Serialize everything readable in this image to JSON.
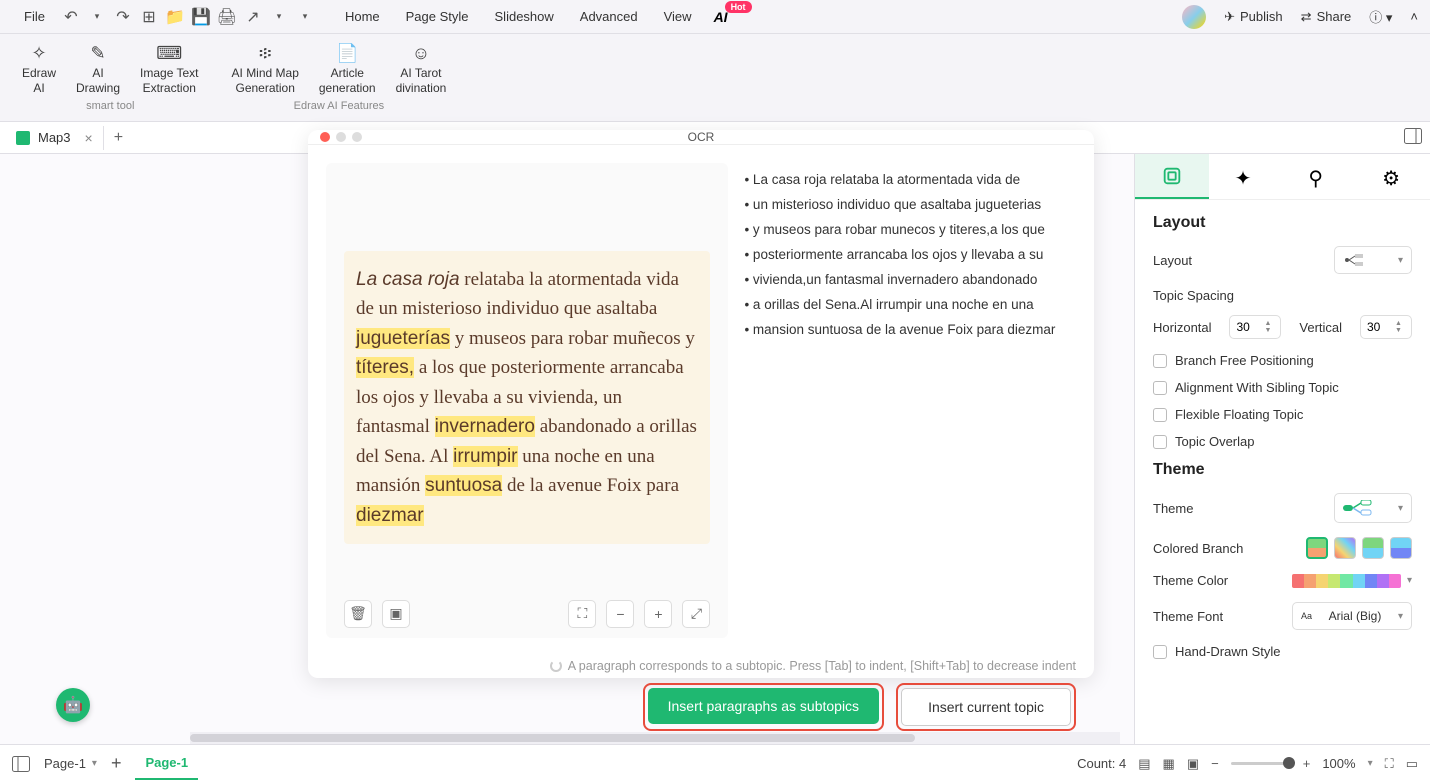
{
  "top_menu": {
    "file": "File",
    "items": [
      "Home",
      "Page Style",
      "Slideshow",
      "Advanced",
      "View"
    ],
    "ai_label": "AI",
    "hot_badge": "Hot",
    "publish": "Publish",
    "share": "Share"
  },
  "ribbon": {
    "group1_name": "smart tool",
    "group2_name": "Edraw AI Features",
    "items": [
      {
        "label": "Edraw\nAI"
      },
      {
        "label": "AI\nDrawing"
      },
      {
        "label": "Image Text\nExtraction"
      },
      {
        "label": "AI Mind Map\nGeneration"
      },
      {
        "label": "Article\ngeneration"
      },
      {
        "label": "AI Tarot\ndivination"
      }
    ]
  },
  "doc_tab": {
    "name": "Map3"
  },
  "ocr": {
    "title": "OCR",
    "source_html": "<span class='italic'>La casa roja</span> relataba la atormentada vida de un misterioso individuo que asaltaba <span class='hl'>jugueterías</span> y museos para robar muñecos y <span class='hl'>títeres,</span> a los que posteriormente arrancaba los ojos y llevaba a su vivienda, un fantasmal <span class='hl'>invernadero</span> abandonado a orillas del Sena. Al <span class='hl'>irrumpir</span> una noche en una mansión <span class='hl'>suntuosa</span> de la avenue Foix para <span class='hl'>diezmar</span>",
    "bullets": [
      "La casa roja relataba la atormentada vida de",
      "un misterioso individuo que asaltaba jugueterias",
      "y museos para robar munecos y titeres,a los que",
      "posteriormente arrancaba los ojos y llevaba a su",
      "vivienda,un fantasmal invernadero abandonado",
      "a orillas del Sena.Al irrumpir una noche en una",
      "mansion suntuosa de la avenue Foix para diezmar"
    ],
    "hint": "A paragraph corresponds to a subtopic. Press [Tab] to indent, [Shift+Tab] to decrease indent",
    "btn_primary": "Insert paragraphs as subtopics",
    "btn_secondary": "Insert current topic"
  },
  "side_panel": {
    "layout_h": "Layout",
    "layout_label": "Layout",
    "topic_spacing": "Topic Spacing",
    "horizontal": "Horizontal",
    "horizontal_val": "30",
    "vertical": "Vertical",
    "vertical_val": "30",
    "checks": [
      "Branch Free Positioning",
      "Alignment With Sibling Topic",
      "Flexible Floating Topic",
      "Topic Overlap"
    ],
    "theme_h": "Theme",
    "theme_label": "Theme",
    "colored_branch": "Colored Branch",
    "theme_color": "Theme Color",
    "theme_font": "Theme Font",
    "theme_font_val": "Arial (Big)",
    "hand_drawn": "Hand-Drawn Style",
    "color_strip": [
      "#f57171",
      "#f5a171",
      "#f5d471",
      "#c6e871",
      "#71e8a4",
      "#71d4f5",
      "#7186f5",
      "#b071f5",
      "#f571d4"
    ]
  },
  "status_bar": {
    "page_select": "Page-1",
    "page_tab": "Page-1",
    "count_label": "Count: 4",
    "zoom": "100%"
  }
}
